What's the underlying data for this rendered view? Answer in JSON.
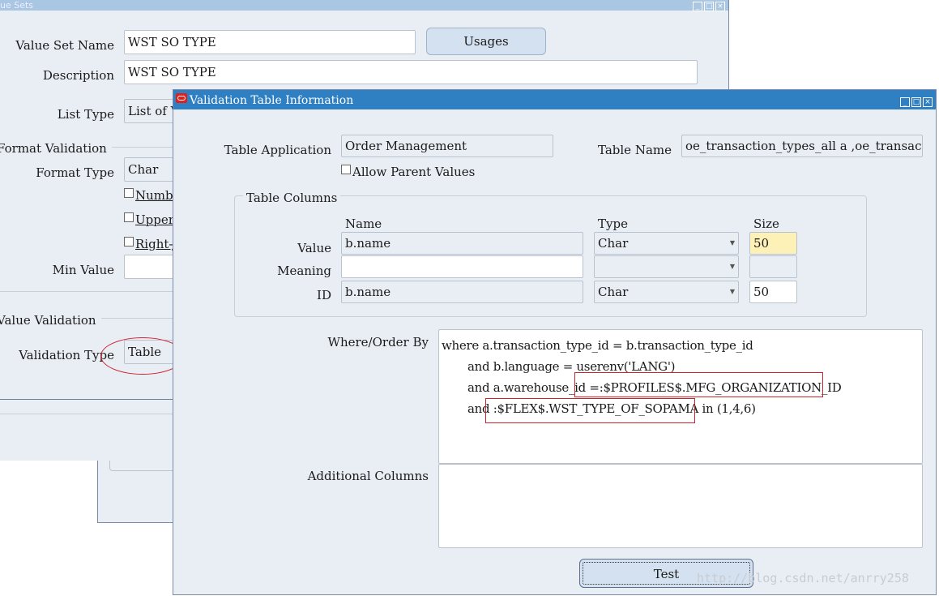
{
  "back_window": {
    "title": "ue Sets",
    "value_set_name_label": "Value Set Name",
    "value_set_name": "WST SO TYPE",
    "usages_button": "Usages",
    "description_label": "Description",
    "description": "WST SO TYPE",
    "list_type_label": "List Type",
    "list_type": "List of V",
    "format_validation_label": "Format Validation",
    "format_type_label": "Format Type",
    "format_type": "Char",
    "checkboxes": [
      "Numbe",
      "Upperc",
      "Right-j"
    ],
    "min_value_label": "Min Value",
    "min_value": "",
    "value_validation_label": "Value Validation",
    "validation_type_label": "Validation Type",
    "validation_type": "Table"
  },
  "dialog": {
    "title": "Validation Table Information",
    "table_application_label": "Table Application",
    "table_application": "Order Management",
    "table_name_label": "Table Name",
    "table_name": "oe_transaction_types_all a ,oe_transaction_types",
    "allow_parent_values": "Allow Parent Values",
    "table_columns_label": "Table Columns",
    "col_headers": {
      "name": "Name",
      "type": "Type",
      "size": "Size"
    },
    "rows": [
      {
        "label": "Value",
        "name": "b.name",
        "type": "Char",
        "size": "50"
      },
      {
        "label": "Meaning",
        "name": "",
        "type": "",
        "size": ""
      },
      {
        "label": "ID",
        "name": "b.name",
        "type": "Char",
        "size": "50"
      }
    ],
    "where_label": "Where/Order By",
    "where_lines": [
      "where a.transaction_type_id = b.transaction_type_id",
      "and b.language = userenv('LANG')",
      "and a.warehouse_id =",
      ":$PROFILES$.MFG_ORGANIZATION_ID",
      "and ",
      ":$FLEX$.WST_TYPE_OF_SOPAMA",
      " in (1,4,6)"
    ],
    "additional_columns_label": "Additional Columns",
    "additional_columns": "",
    "test_button": "Test"
  },
  "watermark": "http://blog.csdn.net/anrry258",
  "colors": {
    "dialog_title": "#2f80c3",
    "back_title": "#a9c6e2",
    "highlight": "#d0202a",
    "required_field": "#fdf1b8"
  }
}
